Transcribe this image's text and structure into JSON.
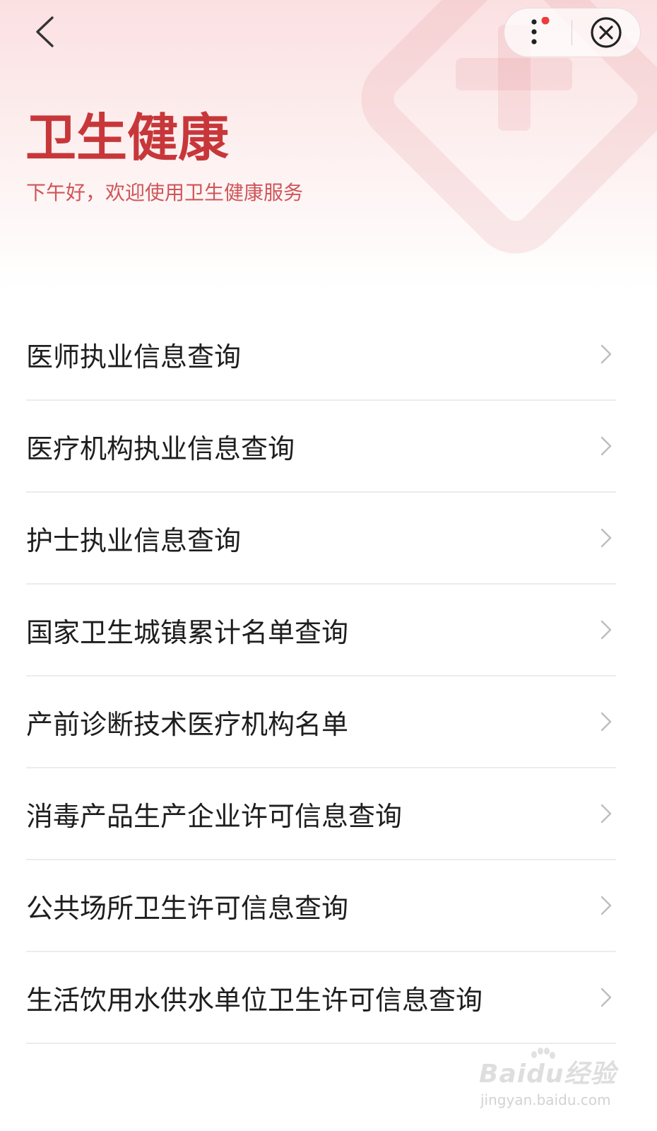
{
  "header": {
    "title": "卫生健康",
    "subtitle": "下午好，欢迎使用卫生健康服务",
    "back_icon": "chevron-left-icon",
    "more_icon": "more-vertical-icon",
    "close_icon": "close-circle-icon",
    "has_notification_dot": true
  },
  "menu": {
    "items": [
      {
        "label": "医师执业信息查询"
      },
      {
        "label": "医疗机构执业信息查询"
      },
      {
        "label": "护士执业信息查询"
      },
      {
        "label": "国家卫生城镇累计名单查询"
      },
      {
        "label": "产前诊断技术医疗机构名单"
      },
      {
        "label": "消毒产品生产企业许可信息查询"
      },
      {
        "label": "公共场所卫生许可信息查询"
      },
      {
        "label": "生活饮用水供水单位卫生许可信息查询"
      }
    ],
    "chevron_icon": "chevron-right-icon"
  },
  "watermark": {
    "brand": "Baidu经验",
    "url": "jingyan.baidu.com"
  },
  "colors": {
    "accent": "#c7373a",
    "subtitle": "#cf5559",
    "notification_dot": "#ef3b3b",
    "text": "#1e1e1e",
    "divider": "#ececec"
  }
}
